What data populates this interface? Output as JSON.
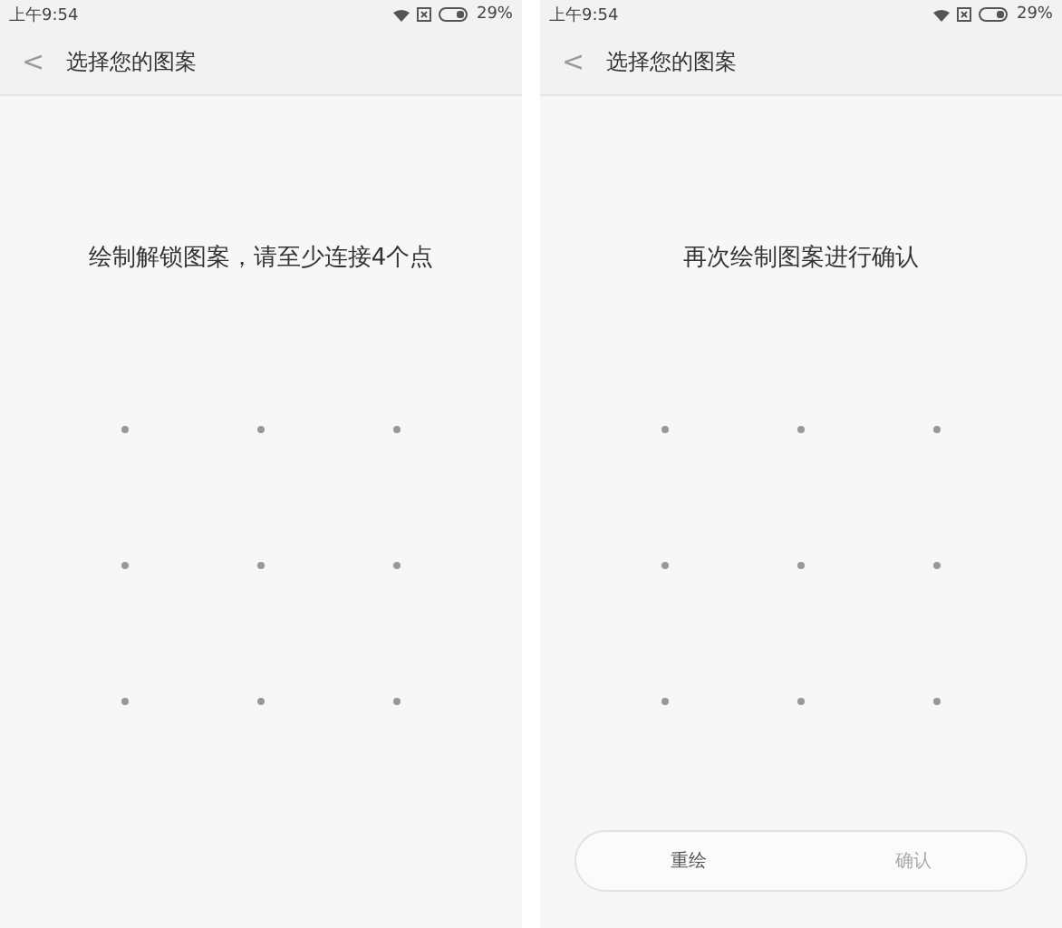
{
  "screens": [
    {
      "status_bar": {
        "time": "上午9:54",
        "battery": "29%"
      },
      "header": {
        "back": "<",
        "title": "选择您的图案"
      },
      "prompt": "绘制解锁图案，请至少连接4个点"
    },
    {
      "status_bar": {
        "time": "上午9:54",
        "battery": "29%"
      },
      "header": {
        "back": "<",
        "title": "选择您的图案"
      },
      "prompt": "再次绘制图案进行确认",
      "buttons": [
        {
          "label": "重绘",
          "disabled": false
        },
        {
          "label": "确认",
          "disabled": true
        }
      ]
    }
  ]
}
